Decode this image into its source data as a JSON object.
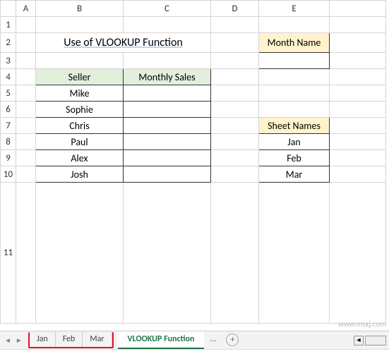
{
  "columns": [
    "A",
    "B",
    "C",
    "D",
    "E"
  ],
  "rows": [
    "1",
    "2",
    "3",
    "4",
    "5",
    "6",
    "7",
    "8",
    "9",
    "10",
    "11"
  ],
  "title": "Use of VLOOKUP Function",
  "seller_table": {
    "headers": [
      "Seller",
      "Monthly Sales"
    ],
    "rows": [
      {
        "seller": "Mike",
        "sales": ""
      },
      {
        "seller": "Sophie",
        "sales": ""
      },
      {
        "seller": "Chris",
        "sales": ""
      },
      {
        "seller": "Paul",
        "sales": ""
      },
      {
        "seller": "Alex",
        "sales": ""
      },
      {
        "seller": "Josh",
        "sales": ""
      }
    ]
  },
  "month_name": {
    "header": "Month Name",
    "value": ""
  },
  "sheet_names": {
    "header": "Sheet Names",
    "items": [
      "Jan",
      "Feb",
      "Mar"
    ]
  },
  "tabs": {
    "items": [
      "Jan",
      "Feb",
      "Mar"
    ],
    "active": "VLOOKUP Function",
    "more": "..."
  },
  "watermark": "www.msxj.com"
}
